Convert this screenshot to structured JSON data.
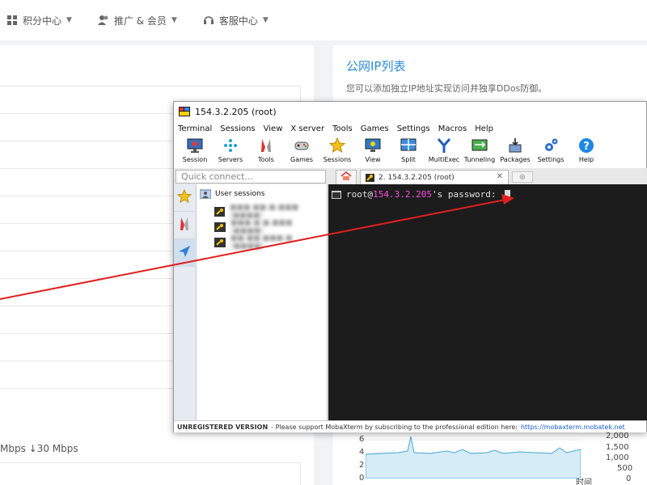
{
  "nav": [
    {
      "label": "积分中心",
      "icon": "grid-icon"
    },
    {
      "label": "推广 & 会员",
      "icon": "users-icon"
    },
    {
      "label": "客服中心",
      "icon": "headset-icon"
    }
  ],
  "right_panel": {
    "title": "公网IP列表",
    "description": "您可以添加独立IP地址实现访问并独享DDos防御。"
  },
  "left_panel": {
    "speed_text": "Mbps  ↓30 Mbps"
  },
  "chart": {
    "y_ticks": [
      "6",
      "4",
      "2",
      "0"
    ],
    "right_ticks": [
      "2,000",
      "1,500",
      "1,000",
      "500",
      "0"
    ],
    "time_label": "时间"
  },
  "moba": {
    "title": "154.3.2.205 (root)",
    "menu": [
      "Terminal",
      "Sessions",
      "View",
      "X server",
      "Tools",
      "Games",
      "Settings",
      "Macros",
      "Help"
    ],
    "tools": [
      {
        "label": "Session",
        "icon": "monitor-icon"
      },
      {
        "label": "Servers",
        "icon": "servers-icon"
      },
      {
        "label": "Tools",
        "icon": "tools-icon"
      },
      {
        "label": "Games",
        "icon": "gamepad-icon"
      },
      {
        "label": "Sessions",
        "icon": "star-icon"
      },
      {
        "label": "View",
        "icon": "view-icon"
      },
      {
        "label": "Split",
        "icon": "split-icon"
      },
      {
        "label": "MultiExec",
        "icon": "multiexec-icon"
      },
      {
        "label": "Tunneling",
        "icon": "tunneling-icon"
      },
      {
        "label": "Packages",
        "icon": "packages-icon"
      },
      {
        "label": "Settings",
        "icon": "settings-icon"
      },
      {
        "label": "Help",
        "icon": "help-icon"
      }
    ],
    "quick_connect_placeholder": "Quick connect...",
    "session_tab": "2. 154.3.2.205 (root)",
    "user_sessions": "User sessions",
    "session_items": [
      "■■■.■■.■.■■■ (■■■■)",
      "■■■.■.■.■■■ (■■■■)",
      "■■.■■.■■■.■ (■■■■)"
    ],
    "prompt_prefix": "root@",
    "prompt_host": "154.3.2.205",
    "prompt_suffix": "'s password: ",
    "status_strong": "UNREGISTERED VERSION",
    "status_text": "- Please support MobaXterm by subscribing to the professional edition here:",
    "status_link": "https://mobaxterm.mobatek.net"
  },
  "colors": {
    "accent": "#2c8ad8",
    "arrow": "#e02020",
    "terminal_bg": "#1c1c1c",
    "host": "#ff4ce0"
  }
}
